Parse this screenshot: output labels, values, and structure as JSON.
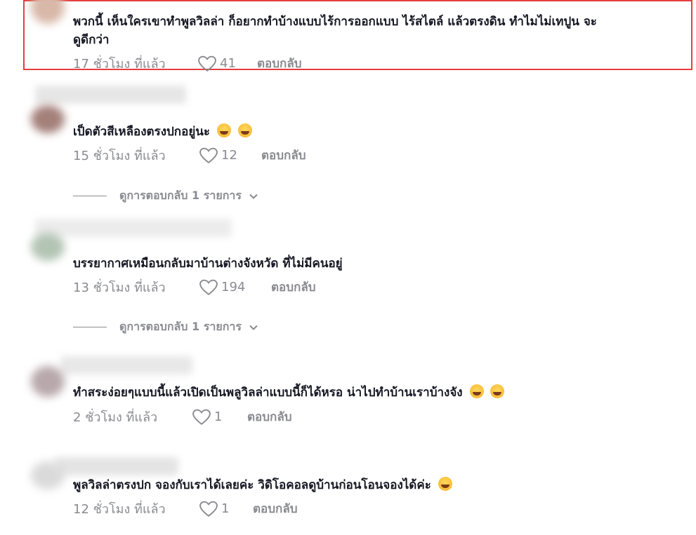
{
  "comments": [
    {
      "text_line1": "พวกนี้ เห็นใครเขาทำพูลวิลล่า ก็อยากทำบ้างแบบไร้การออกแบบ ไร้สไตล์ แล้วตรงดิน ทำไมไม่เทปูน จะ",
      "text_line2": "ดูดีกว่า",
      "time": "17 ชั่วโมง ที่แล้ว",
      "likes": "41",
      "reply": "ตอบกลับ",
      "highlighted": true
    },
    {
      "text": "เป็ดตัวสีเหลืองตรงปกอยู่นะ",
      "emojis": [
        "sweat-smile-emoji",
        "laugh-tears-emoji"
      ],
      "time": "15 ชั่วโมง ที่แล้ว",
      "likes": "12",
      "reply": "ตอบกลับ",
      "view_replies": "ดูการตอบกลับ 1 รายการ"
    },
    {
      "text": "บรรยากาศเหมือนกลับมาบ้านต่างจังหวัด ที่ไม่มีคนอยู่",
      "time": "13 ชั่วโมง ที่แล้ว",
      "likes": "194",
      "reply": "ตอบกลับ",
      "view_replies": "ดูการตอบกลับ 1 รายการ"
    },
    {
      "text": "ทำสระง่อยๆแบบนี้แล้วเปิดเป็นพลูวิลล่าแบบนี้ก็ได้หรอ น่าไปทำบ้านเราบ้างจัง",
      "emojis": [
        "laugh-tears-emoji",
        "laugh-tears-emoji"
      ],
      "time": "2 ชั่วโมง ที่แล้ว",
      "likes": "1",
      "reply": "ตอบกลับ"
    },
    {
      "text": "พูลวิลล่าตรงปก จองกับเราได้เลยค่ะ วิดิโอคอลดูบ้านก่อนโอนจองได้ค่ะ",
      "emojis": [
        "smile-emoji"
      ],
      "time": "12 ชั่วโมง ที่แล้ว",
      "likes": "1",
      "reply": "ตอบกลับ"
    }
  ],
  "colors": {
    "highlight": "#e53e3e",
    "muted": "#8a8b91",
    "text": "#161823"
  }
}
